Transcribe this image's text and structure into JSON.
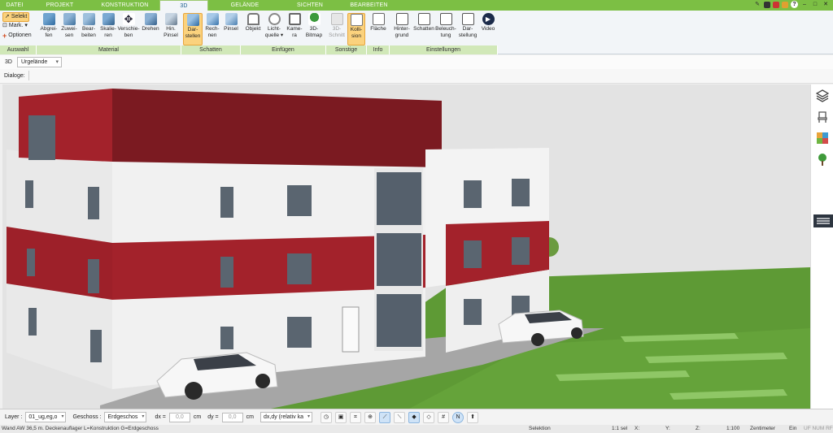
{
  "tabs": [
    {
      "label": "DATEI",
      "active": false
    },
    {
      "label": "PROJEKT",
      "active": false
    },
    {
      "label": "KONSTRUKTION",
      "active": false
    },
    {
      "label": "3D",
      "active": true
    },
    {
      "label": "GELÄNDE",
      "active": false
    },
    {
      "label": "SICHTEN",
      "active": false
    },
    {
      "label": "BEARBEITEN",
      "active": false
    }
  ],
  "ribbon": {
    "auswahl": {
      "select_label": "Selekt",
      "mark_label": "Mark.",
      "options_label": "Optionen",
      "group_label": "Auswahl"
    },
    "material": {
      "group_label": "Material",
      "buttons": [
        "Abgrei-\nfen",
        "Zuwei-\nsen",
        "Bear-\nbeiten",
        "Skalie-\nren",
        "Verschie-\nben",
        "Drehen",
        "Hin.\nPinsel"
      ]
    },
    "schatten": {
      "group_label": "Schatten",
      "buttons": [
        "Dar-\nstellen",
        "Rech-\nnen",
        "Pinsel"
      ]
    },
    "einfuegen": {
      "group_label": "Einfügen",
      "buttons": [
        "Objekt",
        "Licht-\nquelle ▾",
        "Kame-\nra",
        "3D-\nBitmap"
      ]
    },
    "sonstige": {
      "group_label": "Sonstige",
      "buttons": [
        "3D-\nSchnitt",
        "Kolli-\nsion"
      ]
    },
    "info": {
      "group_label": "Info",
      "buttons": [
        "Fläche"
      ]
    },
    "einstellungen": {
      "group_label": "Einstellungen",
      "buttons": [
        "Hinter-\ngrund",
        "Schatten",
        "Beleuch-\ntung",
        "Dar-\nstellung",
        "Video"
      ]
    }
  },
  "toolrow": {
    "view_label": "3D",
    "terrain_select": "Urgelände"
  },
  "dialog_label": "Dialoge:",
  "bottombar": {
    "layer_label": "Layer :",
    "layer_value": "01_ug,eg,o",
    "floor_label": "Geschoss :",
    "floor_value": "Erdgeschos",
    "dx_label": "dx =",
    "dx_value": "0,0",
    "dx_unit": "cm",
    "dy_label": "dy =",
    "dy_value": "0,0",
    "dy_unit": "cm",
    "mode_value": "dx,dy (relativ ka"
  },
  "status": {
    "left": "Wand AW 36,5 m. Deckenauflager L=Konstruktion G=Erdgeschoss",
    "selection": "Selektion",
    "scale": "1:1 sel",
    "x": "X:",
    "y": "Y:",
    "z": "Z:",
    "ratio": "1:100",
    "unit": "Zentimeter",
    "on": "Ein",
    "flags": "UF  NUM  RF"
  },
  "colors": {
    "brand_green": "#7cbf44",
    "facade_red": "#a3222b",
    "facade_white": "#ececec",
    "lawn": "#5e9a35"
  },
  "icons": [
    "layers-icon",
    "chair-icon",
    "material-icon",
    "tree-icon",
    "menu-icon"
  ]
}
